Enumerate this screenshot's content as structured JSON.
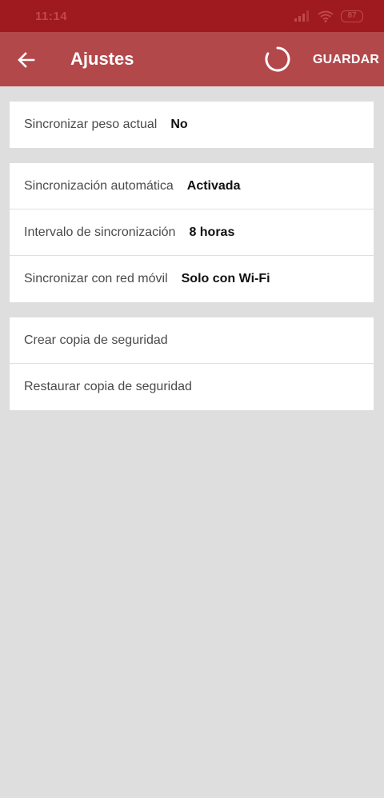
{
  "status_bar": {
    "time": "11:14",
    "battery": "87",
    "icons": [
      "signal-icon",
      "wifi-icon",
      "battery-icon"
    ]
  },
  "app_bar": {
    "title": "Ajustes",
    "save_label": "GUARDAR",
    "icons": [
      "back-arrow-icon",
      "loading-spinner-icon"
    ]
  },
  "colors": {
    "status_bar": "#9e1a1e",
    "app_bar": "#b3484b",
    "background": "#dedede",
    "card": "#ffffff"
  },
  "sections": [
    {
      "rows": [
        {
          "label": "Sincronizar peso actual",
          "value": "No"
        }
      ]
    },
    {
      "rows": [
        {
          "label": "Sincronización automática",
          "value": "Activada"
        },
        {
          "label": "Intervalo de sincronización",
          "value": "8 horas"
        },
        {
          "label": "Sincronizar con red móvil",
          "value": "Solo con Wi-Fi"
        }
      ]
    },
    {
      "rows": [
        {
          "label": "Crear copia de seguridad"
        },
        {
          "label": "Restaurar copia de seguridad"
        }
      ]
    }
  ]
}
